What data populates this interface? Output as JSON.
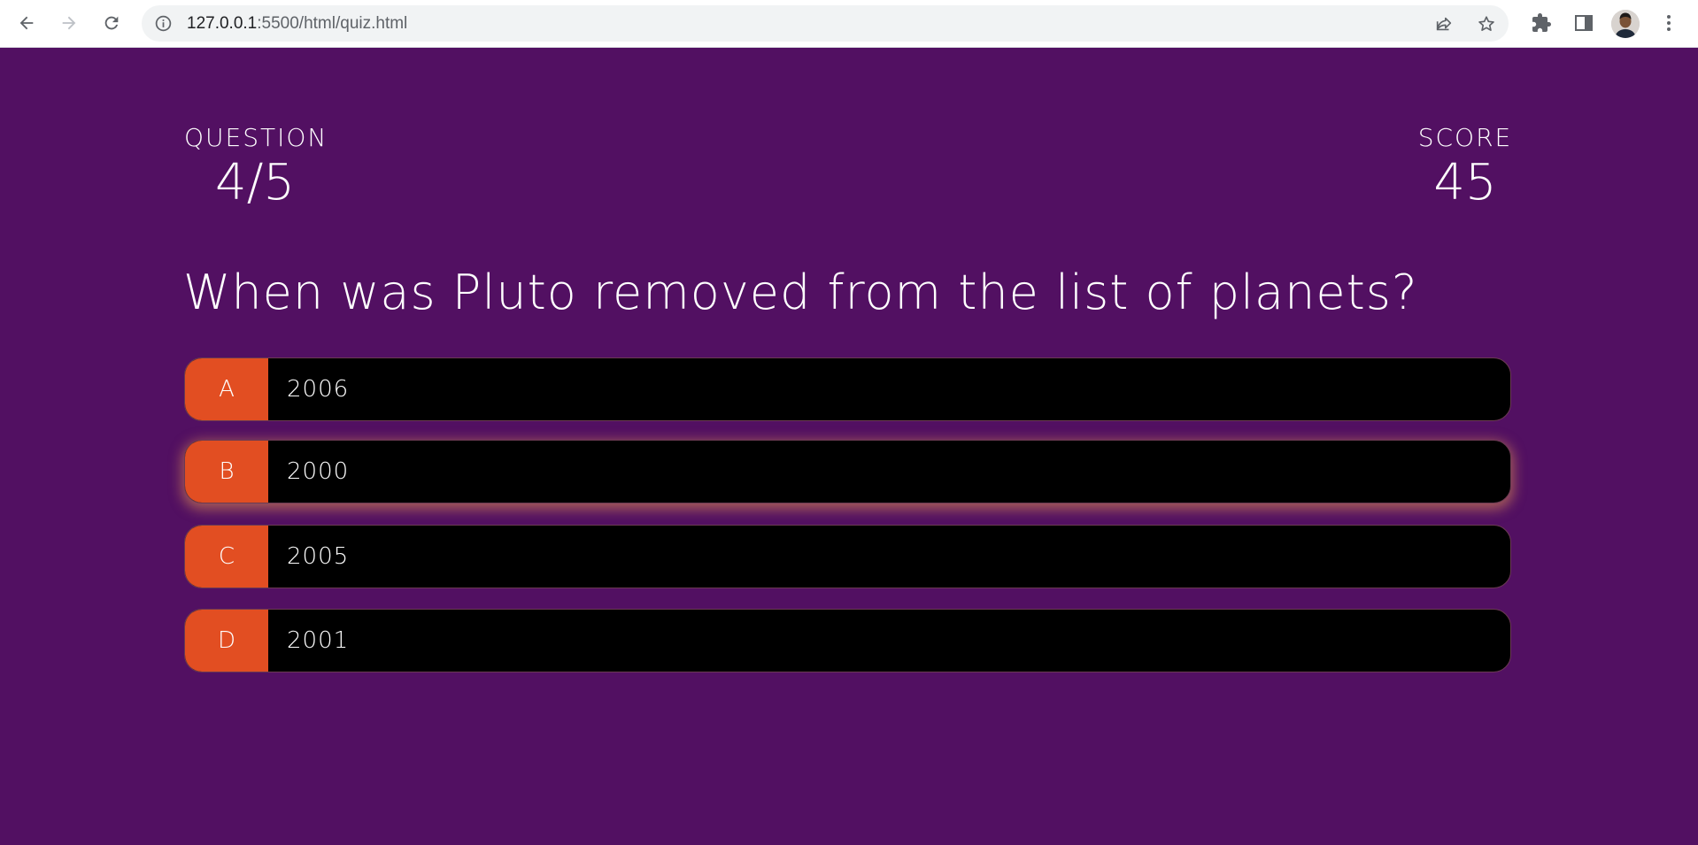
{
  "browser": {
    "url_host": "127.0.0.1",
    "url_path": ":5500/html/quiz.html",
    "icons": {
      "back": "back-arrow-icon",
      "forward": "forward-arrow-icon",
      "reload": "reload-icon",
      "site_info": "info-icon",
      "share": "share-icon",
      "bookmark": "star-icon",
      "extensions": "puzzle-icon",
      "side_panel": "side-panel-icon",
      "menu": "kebab-menu-icon"
    }
  },
  "hud": {
    "question_label": "QUESTION",
    "question_progress": "4/5",
    "score_label": "SCORE",
    "score_value": "45"
  },
  "question": {
    "text": "When was Pluto removed from the list of planets?"
  },
  "choices": [
    {
      "prefix": "A",
      "text": "2006",
      "hovered": false
    },
    {
      "prefix": "B",
      "text": "2000",
      "hovered": true
    },
    {
      "prefix": "C",
      "text": "2005",
      "hovered": false
    },
    {
      "prefix": "D",
      "text": "2001",
      "hovered": false
    }
  ],
  "colors": {
    "page_background": "#521062",
    "choice_prefix": "#e24e22",
    "choice_background": "#000000",
    "hover_glow": "#e69650"
  }
}
